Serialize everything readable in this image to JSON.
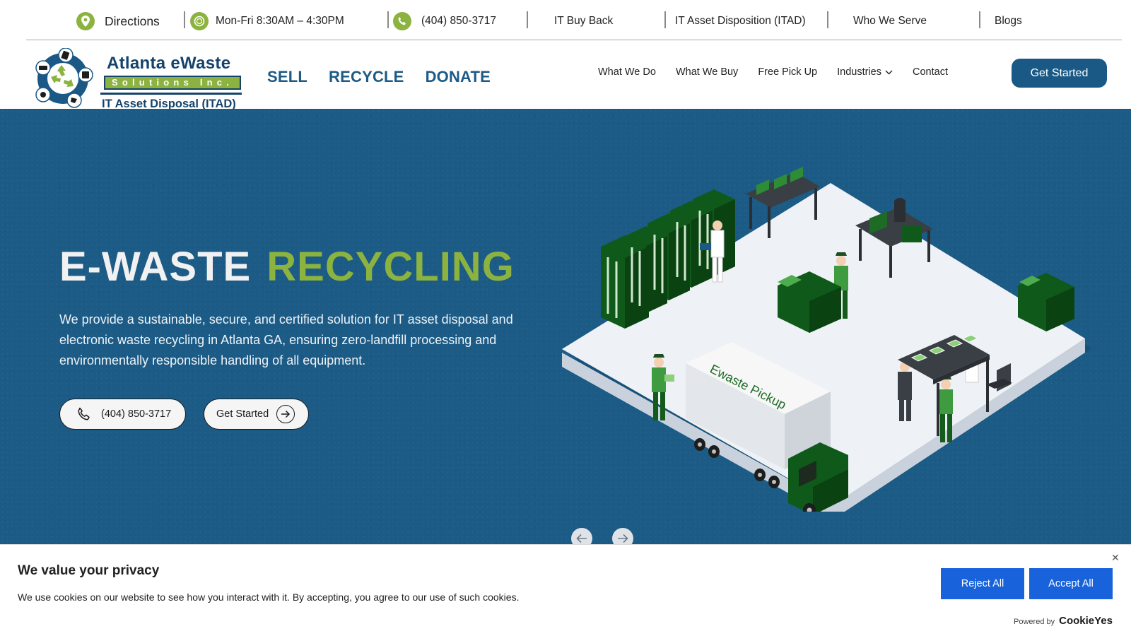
{
  "topbar": {
    "directions": "Directions",
    "hours": "Mon-Fri 8:30AM – 4:30PM",
    "phone": "(404) 850-3717",
    "links": [
      "IT Buy Back",
      "IT Asset Disposition (ITAD)",
      "Who We Serve",
      "Blogs"
    ]
  },
  "logo": {
    "title": "Atlanta eWaste",
    "subtitle": "Solutions Inc.",
    "tagline": "IT Asset Disposal (ITAD)"
  },
  "main_links": [
    "SELL",
    "RECYCLE",
    "DONATE"
  ],
  "nav": {
    "what_we_do": "What We Do",
    "what_we_buy": "What We Buy",
    "free_pick_up": "Free Pick Up",
    "industries": "Industries",
    "contact": "Contact",
    "cta": "Get Started"
  },
  "hero": {
    "title_white": "E-WASTE",
    "title_green": "RECYCLING",
    "body": "We provide a sustainable, secure, and certified solution for IT asset disposal and electronic waste recycling in Atlanta GA, ensuring zero-landfill processing and environmentally responsible handling of all equipment.",
    "phone_button": "(404) 850-3717",
    "start_button": "Get Started",
    "truck_label": "Ewaste Pickup"
  },
  "cookie": {
    "title": "We value your privacy",
    "text": "We use cookies on our website to see how you interact with it. By accepting, you agree to our use of such cookies.",
    "reject": "Reject All",
    "accept": "Accept All",
    "powered_by": "Powered by",
    "brand": "CookieYes"
  },
  "colors": {
    "brand_blue": "#1a5986",
    "hero_blue": "#1b5b86",
    "brand_green": "#8cb23f",
    "cookie_blue": "#1863dc"
  },
  "icons": [
    "map-pin-icon",
    "clock-icon",
    "phone-icon",
    "chevron-down-icon",
    "arrow-right-circle-icon",
    "arrow-left-icon",
    "arrow-right-icon",
    "close-icon",
    "recycle-icon"
  ]
}
